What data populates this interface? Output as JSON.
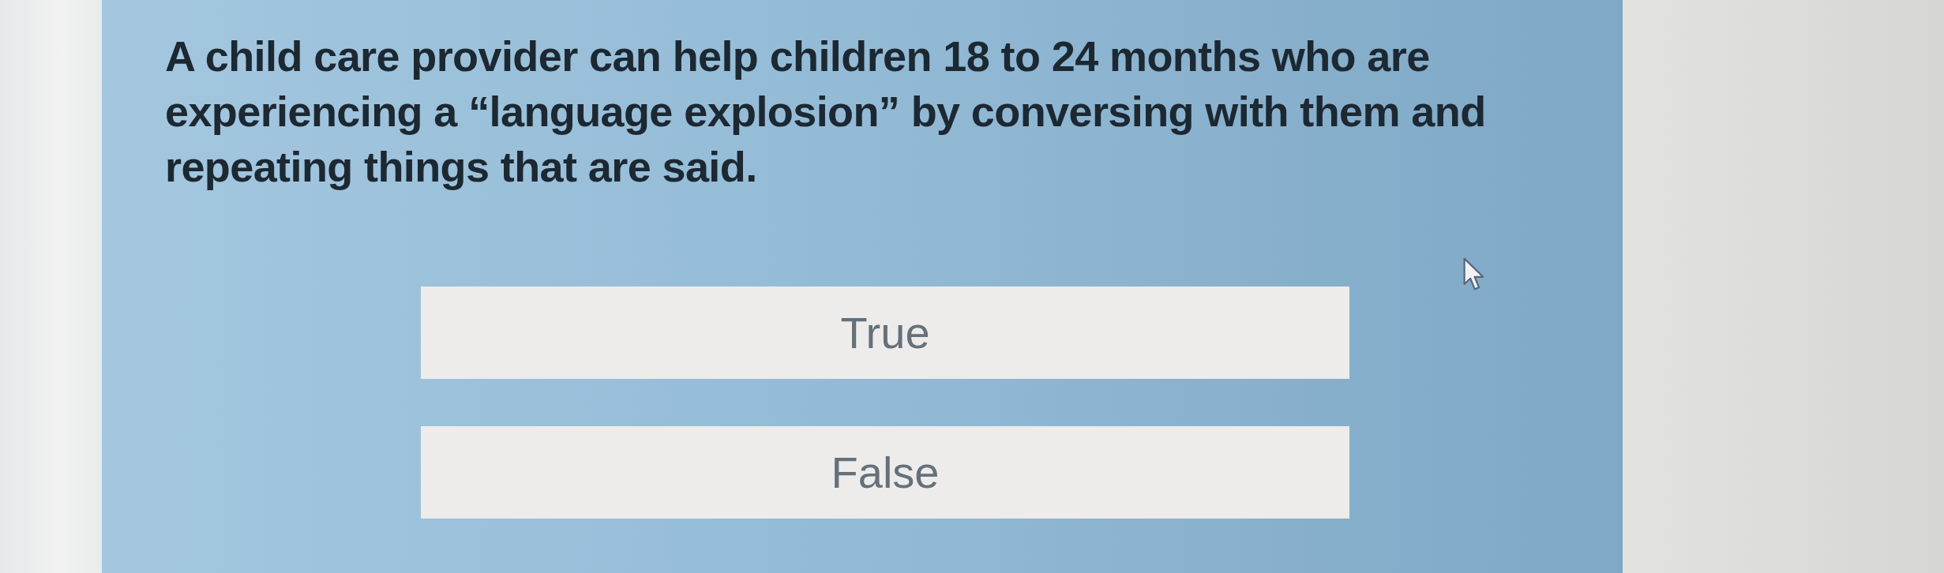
{
  "question": {
    "text": "A child care provider can help children 18 to 24 months who are experiencing a “language explosion” by conversing with them and repeating things that are said."
  },
  "options": [
    {
      "label": "True"
    },
    {
      "label": "False"
    }
  ]
}
